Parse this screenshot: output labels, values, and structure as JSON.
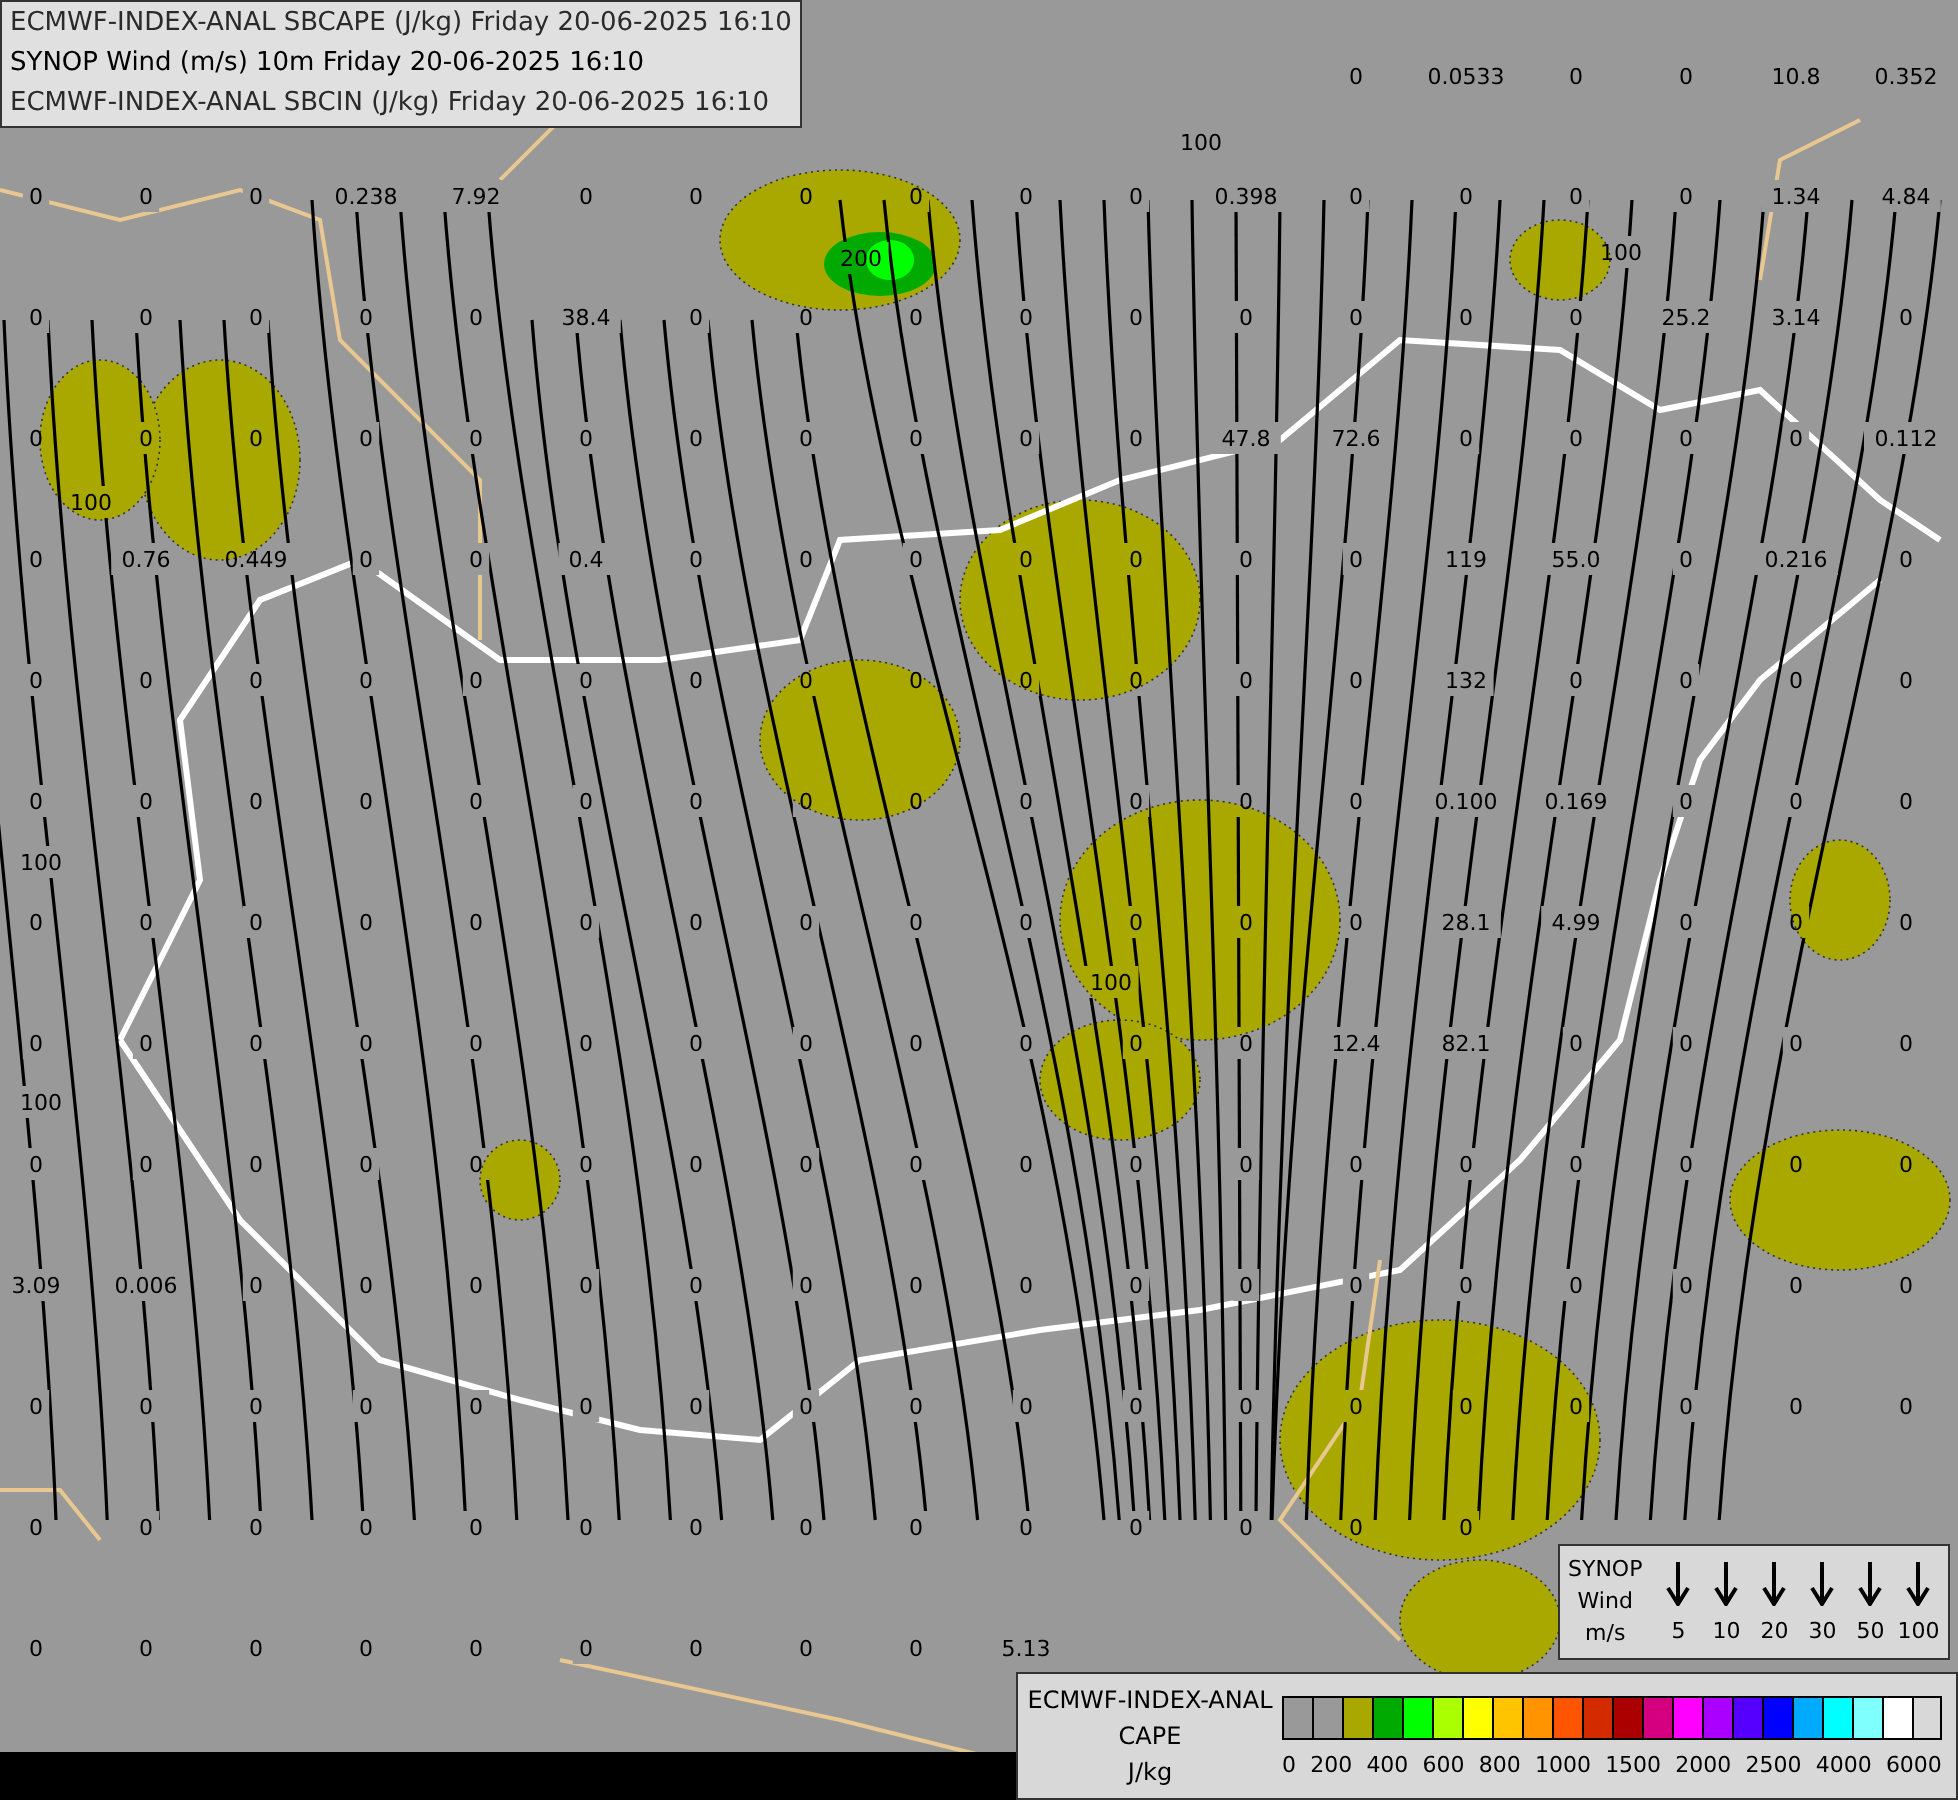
{
  "header": {
    "lines": [
      {
        "text": "ECMWF-INDEX-ANAL SBCAPE (J/kg) Friday 20-06-2025 16:10",
        "kind": "dim"
      },
      {
        "text": "SYNOP Wind (m/s) 10m Friday 20-06-2025 16:10",
        "kind": "strong"
      },
      {
        "text": "ECMWF-INDEX-ANAL SBCIN (J/kg) Friday 20-06-2025 16:10",
        "kind": "dim"
      }
    ]
  },
  "top_row": [
    "0",
    "0.0533",
    "0",
    "0",
    "10.8",
    "0.352"
  ],
  "value_grid": [
    [
      "0",
      "0",
      "0",
      "0.238",
      "7.92",
      "0",
      "0",
      "0",
      "0",
      "0",
      "0",
      "0.398",
      "0",
      "0",
      "0",
      "0",
      "1.34",
      "4.84"
    ],
    [
      "0",
      "0",
      "0",
      "0",
      "0",
      "38.4",
      "0",
      "0",
      "0",
      "0",
      "0",
      "0",
      "0",
      "0",
      "0",
      "25.2",
      "3.14",
      "0"
    ],
    [
      "0",
      "0",
      "0",
      "0",
      "0",
      "0",
      "0",
      "0",
      "0",
      "0",
      "0",
      "47.8",
      "72.6",
      "0",
      "0",
      "0",
      "0",
      "0.112"
    ],
    [
      "0",
      "0.76",
      "0.449",
      "0",
      "0",
      "0.4",
      "0",
      "0",
      "0",
      "0",
      "0",
      "0",
      "0",
      "119",
      "55.0",
      "0",
      "0.216",
      "0"
    ],
    [
      "0",
      "0",
      "0",
      "0",
      "0",
      "0",
      "0",
      "0",
      "0",
      "0",
      "0",
      "0",
      "0",
      "132",
      "0",
      "0",
      "0",
      "0"
    ],
    [
      "0",
      "0",
      "0",
      "0",
      "0",
      "0",
      "0",
      "0",
      "0",
      "0",
      "0",
      "0",
      "0",
      "0.100",
      "0.169",
      "0",
      "0",
      "0"
    ],
    [
      "0",
      "0",
      "0",
      "0",
      "0",
      "0",
      "0",
      "0",
      "0",
      "0",
      "0",
      "0",
      "0",
      "28.1",
      "4.99",
      "0",
      "0",
      "0"
    ],
    [
      "0",
      "0",
      "0",
      "0",
      "0",
      "0",
      "0",
      "0",
      "0",
      "0",
      "0",
      "0",
      "12.4",
      "82.1",
      "0",
      "0",
      "0",
      "0"
    ],
    [
      "0",
      "0",
      "0",
      "0",
      "0",
      "0",
      "0",
      "0",
      "0",
      "0",
      "0",
      "0",
      "0",
      "0",
      "0",
      "0",
      "0",
      "0"
    ],
    [
      "3.09",
      "0.006",
      "0",
      "0",
      "0",
      "0",
      "0",
      "0",
      "0",
      "0",
      "0",
      "0",
      "0",
      "0",
      "0",
      "0",
      "0",
      "0"
    ],
    [
      "0",
      "0",
      "0",
      "0",
      "0",
      "0",
      "0",
      "0",
      "0",
      "0",
      "0",
      "0",
      "0",
      "0",
      "0",
      "0",
      "0",
      "0"
    ],
    [
      "0",
      "0",
      "0",
      "0",
      "0",
      "0",
      "0",
      "0",
      "0",
      "0",
      "0",
      "0",
      "0",
      "0"
    ],
    [
      "0",
      "0",
      "0",
      "0",
      "0",
      "0",
      "0",
      "0",
      "0",
      "5.13"
    ]
  ],
  "contour_labels": [
    "200",
    "100",
    "100",
    "100",
    "100",
    "100",
    "100"
  ],
  "wind_legend": {
    "lines": [
      "SYNOP",
      "Wind",
      "m/s"
    ],
    "speeds": [
      "5",
      "10",
      "20",
      "30",
      "50",
      "100"
    ]
  },
  "cape_legend": {
    "lines": [
      "ECMWF-INDEX-ANAL",
      "CAPE",
      "J/kg"
    ],
    "swatches": [
      {
        "color": "#999999"
      },
      {
        "color": "#999999"
      },
      {
        "color": "#a8a800"
      },
      {
        "color": "#00aa00"
      },
      {
        "color": "#00ff00"
      },
      {
        "color": "#aaff00"
      },
      {
        "color": "#ffff00"
      },
      {
        "color": "#ffc400"
      },
      {
        "color": "#ff9400"
      },
      {
        "color": "#ff5500"
      },
      {
        "color": "#d42a00"
      },
      {
        "color": "#aa0000"
      },
      {
        "color": "#d4007f"
      },
      {
        "color": "#ff00ff"
      },
      {
        "color": "#aa00ff"
      },
      {
        "color": "#5500ff"
      },
      {
        "color": "#0000ff"
      },
      {
        "color": "#00aaff"
      },
      {
        "color": "#00ffff"
      },
      {
        "color": "#80ffff"
      },
      {
        "color": "#ffffff"
      }
    ],
    "ticks": [
      "0",
      "200",
      "400",
      "600",
      "800",
      "1000",
      "1500",
      "2000",
      "2500",
      "4000",
      "6000"
    ]
  }
}
